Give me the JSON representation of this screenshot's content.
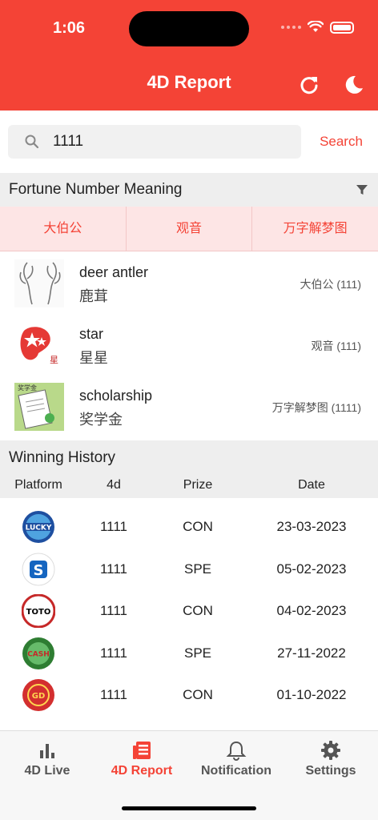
{
  "status_bar": {
    "time": "1:06"
  },
  "header": {
    "title": "4D Report"
  },
  "search": {
    "value": "1111",
    "button_label": "Search"
  },
  "meaning": {
    "title": "Fortune Number Meaning",
    "sources": [
      "大伯公",
      "观音",
      "万字解梦图"
    ],
    "items": [
      {
        "en": "deer antler",
        "zh": "鹿茸",
        "source": "大伯公 (111)",
        "icon": "deer-antler-icon"
      },
      {
        "en": "star",
        "zh": "星星",
        "source": "观音 (111)",
        "icon": "star-icon"
      },
      {
        "en": "scholarship",
        "zh": "奖学金",
        "source": "万字解梦图 (1111)",
        "icon": "scholarship-certificate-icon"
      }
    ]
  },
  "history": {
    "title": "Winning History",
    "columns": [
      "Platform",
      "4d",
      "Prize",
      "Date"
    ],
    "rows": [
      {
        "platform": "lucky-hari-hari-logo",
        "logo_text": "LUCKY",
        "number": "1111",
        "prize": "CON",
        "date": "23-03-2023"
      },
      {
        "platform": "singapore-pools-logo",
        "logo_text": "S",
        "number": "1111",
        "prize": "SPE",
        "date": "05-02-2023"
      },
      {
        "platform": "sports-toto-logo",
        "logo_text": "TOTO",
        "number": "1111",
        "prize": "CON",
        "date": "04-02-2023"
      },
      {
        "platform": "cash-sweep-logo",
        "logo_text": "CASH",
        "number": "1111",
        "prize": "SPE",
        "date": "27-11-2022"
      },
      {
        "platform": "grand-dragon-logo",
        "logo_text": "GD",
        "number": "1111",
        "prize": "CON",
        "date": "01-10-2022"
      }
    ]
  },
  "tabs": [
    {
      "label": "4D Live",
      "icon": "bar-chart-icon",
      "active": false
    },
    {
      "label": "4D Report",
      "icon": "newspaper-icon",
      "active": true
    },
    {
      "label": "Notification",
      "icon": "bell-icon",
      "active": false
    },
    {
      "label": "Settings",
      "icon": "gear-icon",
      "active": false
    }
  ],
  "colors": {
    "accent": "#f44336",
    "section_bg": "#eeeeee",
    "tab_bg": "#fde5e5"
  }
}
